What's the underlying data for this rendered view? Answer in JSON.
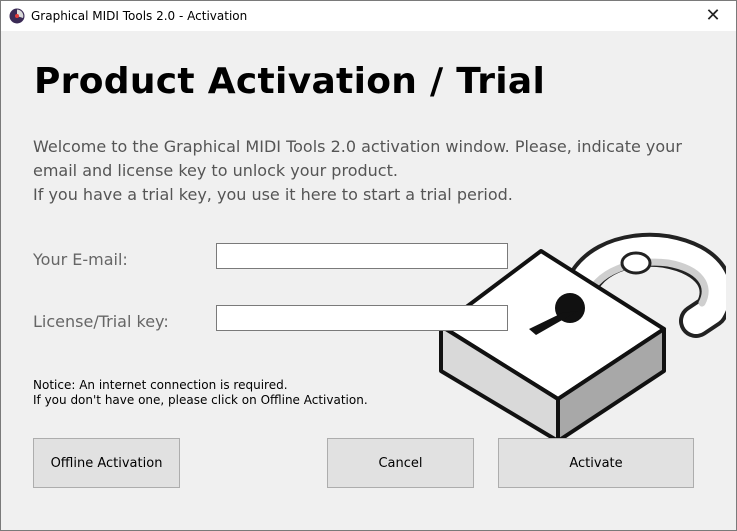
{
  "window": {
    "title": "Graphical MIDI Tools 2.0 - Activation",
    "close_glyph": "✕",
    "app_icon": "gmt-app-icon"
  },
  "main": {
    "heading": "Product Activation / Trial",
    "welcome_lines": [
      "Welcome to the Graphical MIDI Tools 2.0 activation window. Please, indicate your",
      "email and license key to unlock your product.",
      "If you have a trial key, you use it here to start a trial period."
    ]
  },
  "form": {
    "email_label": "Your E-mail:",
    "email_value": "",
    "key_label": "License/Trial key:",
    "key_value": ""
  },
  "illustration": {
    "icon": "open-padlock-icon"
  },
  "notice": {
    "lines": [
      "Notice: An internet connection is required.",
      "If you don't have one, please click on Offline Activation."
    ]
  },
  "buttons": {
    "offline": "Offline Activation",
    "cancel": "Cancel",
    "activate": "Activate"
  }
}
